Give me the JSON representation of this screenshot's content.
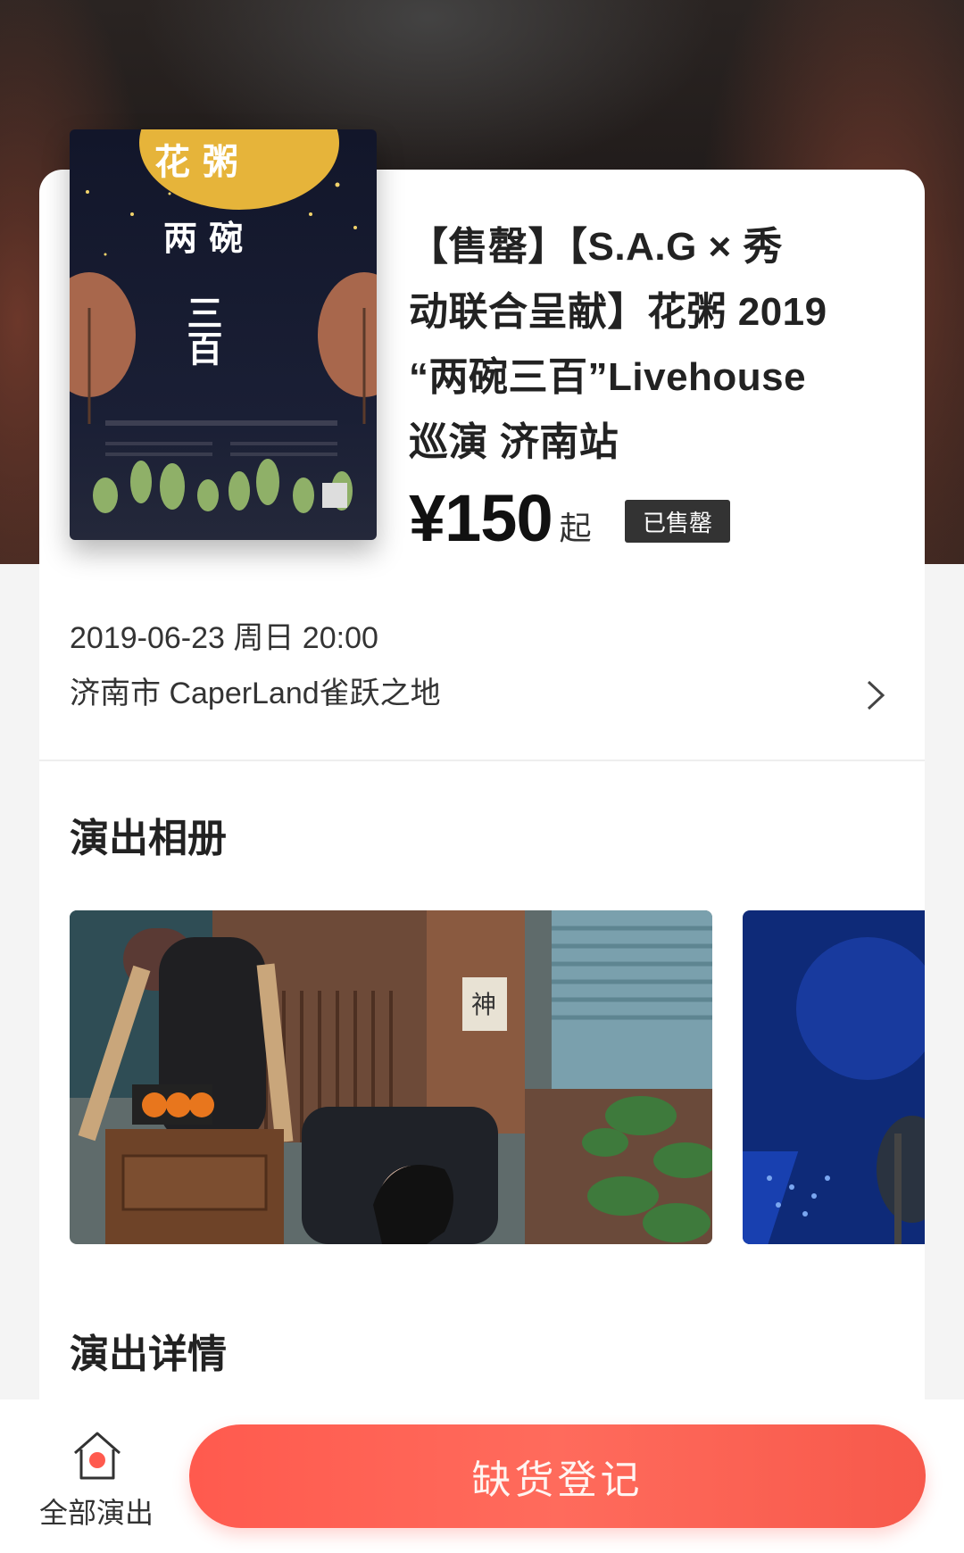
{
  "event": {
    "title_lines": [
      "【售罄】【S.A.G × 秀",
      "动联合呈献】花粥 2019",
      "“两碗三百”Livehouse",
      "巡演 济南站"
    ],
    "price": "¥150",
    "price_suffix": "起",
    "status_badge": "已售罄",
    "datetime": "2019-06-23 周日 20:00",
    "venue": "济南市 CaperLand雀跃之地"
  },
  "poster": {
    "title_top": "花 粥",
    "title_mid": "两 碗",
    "title_vertical": "三百"
  },
  "sections": {
    "album": "演出相册",
    "details": "演出详情"
  },
  "album": {
    "photos": [
      "stage-interior-photo",
      "concert-performance-photo"
    ]
  },
  "bottom_bar": {
    "home_label": "全部演出",
    "cta_label": "缺货登记"
  },
  "colors": {
    "accent": "#ff5a4e",
    "badge_bg": "#333333",
    "card_bg": "#ffffff"
  }
}
